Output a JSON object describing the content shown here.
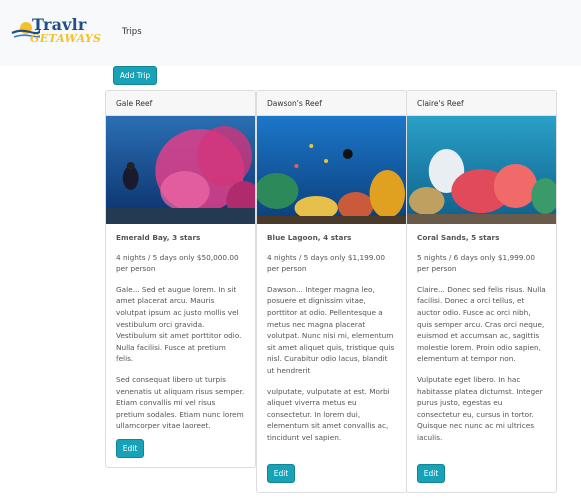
{
  "navbar": {
    "brand_top": "Travlr",
    "brand_bottom": "GETAWAYS",
    "trips_link": "Trips"
  },
  "add_trip_label": "Add Trip",
  "trips": [
    {
      "name": "Gale Reef",
      "resort": "Emerald Bay, 3 stars",
      "price": "4 nights / 5 days only $50,000.00 per person",
      "desc1": "Gale... Sed et augue lorem. In sit amet placerat arcu. Mauris volutpat ipsum ac justo mollis vel vestibulum orci gravida. Vestibulum sit amet porttitor odio. Nulla facilisi. Fusce at pretium felis.",
      "desc2": "Sed consequat libero ut turpis venenatis ut aliquam risus semper. Etiam convallis mi vel risus pretium sodales. Etiam nunc lorem ullamcorper vitae laoreet.",
      "edit_label": "Edit"
    },
    {
      "name": "Dawson's Reef",
      "resort": "Blue Lagoon, 4 stars",
      "price": "4 nights / 5 days only $1,199.00 per person",
      "desc1": "Dawson... Integer magna leo, posuere et dignissim vitae, porttitor at odio. Pellentesque a metus nec magna placerat volutpat. Nunc nisi mi, elementum sit amet aliquet quis, tristique quis nisl. Curabitur odio lacus, blandit ut hendrerit",
      "desc2": "vulputate, vulputate at est. Morbi aliquet viverra metus eu consectetur. In lorem dui, elementum sit amet convallis ac, tincidunt vel sapien.",
      "edit_label": "Edit"
    },
    {
      "name": "Claire's Reef",
      "resort": "Coral Sands, 5 stars",
      "price": "5 nights / 6 days only $1,999.00 per person",
      "desc1": "Claire... Donec sed felis risus. Nulla facilisi. Donec a orci tellus, et auctor odio. Fusce ac orci nibh, quis semper arcu. Cras orci neque, euismod et accumsan ac, sagittis molestie lorem. Proin odio sapien, elementum at tempor non.",
      "desc2": "Vulputate eget libero. In hac habitasse platea dictumst. Integer purus justo, egestas eu consectetur eu, cursus in tortor. Quisque nec nunc ac mi ultrices iaculis.",
      "edit_label": "Edit"
    }
  ],
  "colors": {
    "accent": "#17a2b8",
    "brand_blue": "#1f4e8c",
    "brand_yellow": "#f3c12c"
  }
}
